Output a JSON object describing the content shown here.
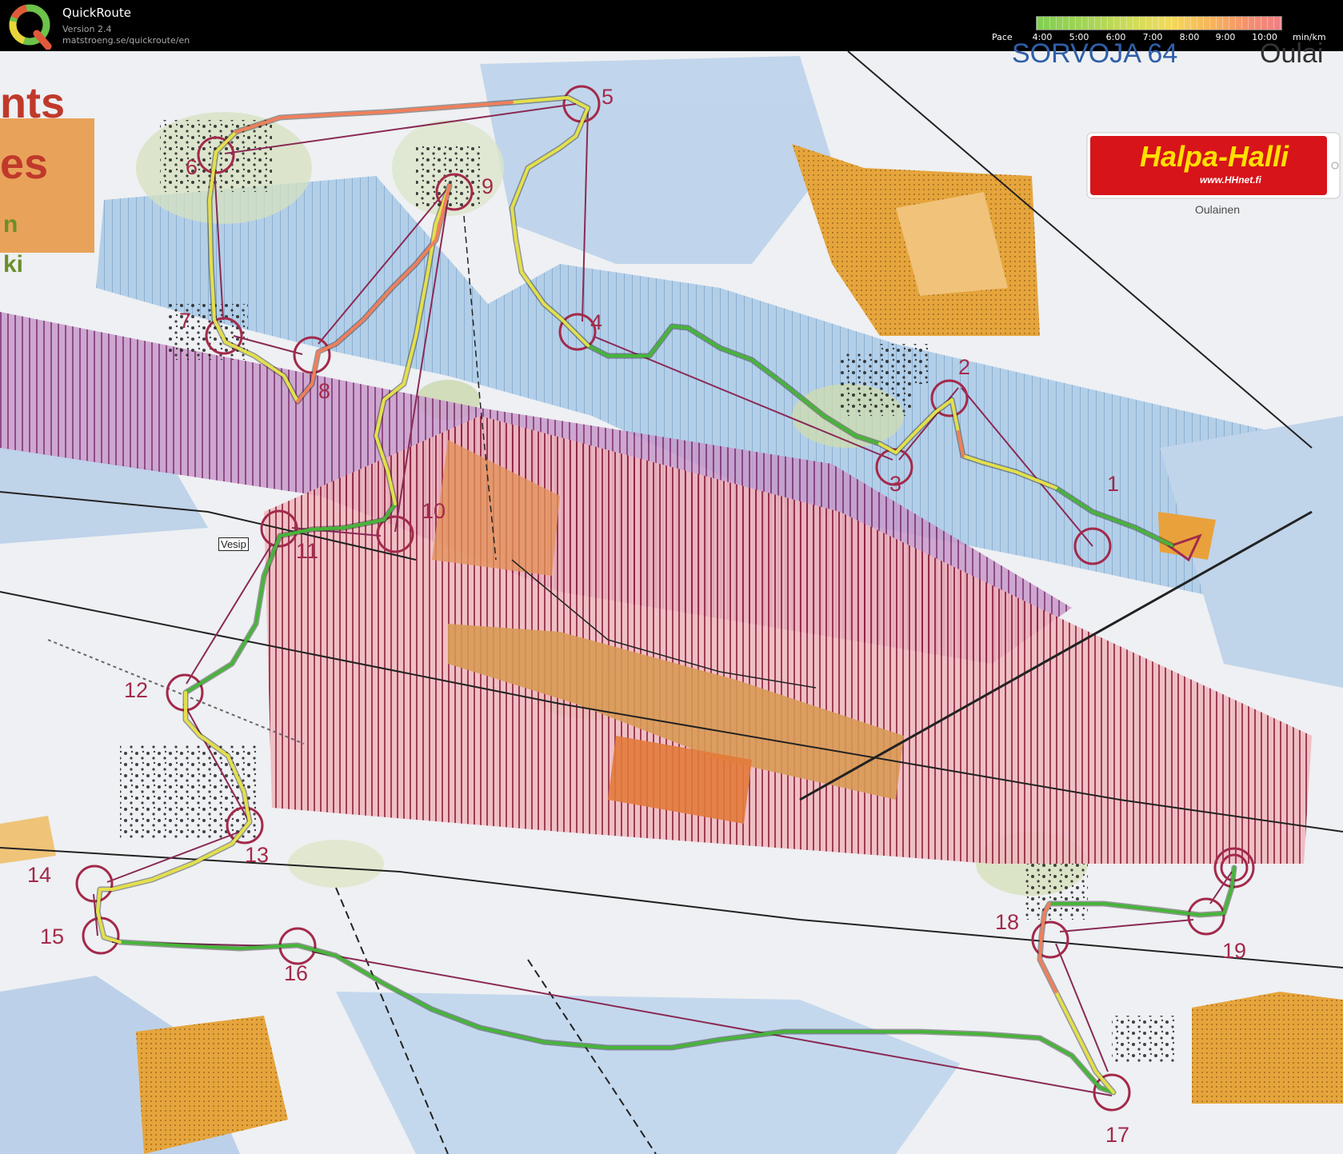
{
  "app": {
    "name": "QuickRoute",
    "version": "Version 2.4",
    "url": "matstroeng.se/quickroute/en"
  },
  "pace_legend": {
    "title": "Pace",
    "ticks": [
      "4:00",
      "5:00",
      "6:00",
      "7:00",
      "8:00",
      "9:00",
      "10:00"
    ],
    "unit": "min/km",
    "colors": [
      "#7fcf52",
      "#d3dd59",
      "#f4d95a",
      "#f7b35b",
      "#f07f86"
    ]
  },
  "map": {
    "sponsor": {
      "name": "Halpa-Halli",
      "url": "www.HHnet.fi",
      "town": "Oulainen"
    },
    "left_banner": {
      "line1": "nts",
      "line2": "es",
      "line3": "n",
      "line4": "ki"
    },
    "top_text": "SORVOJA 64",
    "top_text_right": "Oulai",
    "feature_label": "Vesip",
    "controls": [
      "1",
      "2",
      "3",
      "4",
      "5",
      "6",
      "7",
      "8",
      "9",
      "10",
      "11",
      "12",
      "13",
      "14",
      "15",
      "16",
      "17",
      "18",
      "19"
    ],
    "route_colors": {
      "fast": "#47b43a",
      "medium": "#e3e04b",
      "slow": "#f07f5b"
    }
  }
}
